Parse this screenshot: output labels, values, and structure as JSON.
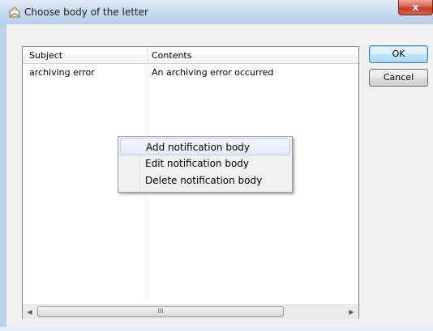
{
  "window": {
    "title": "Choose body of the letter",
    "close_glyph": "x"
  },
  "list": {
    "columns": [
      "Subject",
      "Contents"
    ],
    "rows": [
      {
        "subject": "archiving error",
        "contents": "An archiving error occurred"
      }
    ],
    "scroll": {
      "left_arrow": "◀",
      "right_arrow": "▶",
      "thumb_grip": "III"
    }
  },
  "buttons": {
    "ok": "OK",
    "cancel": "Cancel"
  },
  "context_menu": {
    "items": [
      "Add notification body",
      "Edit notification body",
      "Delete notification body"
    ],
    "highlighted_index": 0
  },
  "icons": [
    "envelope-icon",
    "close-icon",
    "scroll-left-icon",
    "scroll-right-icon"
  ],
  "colors": {
    "title_gradient_top": "#dfeaf6",
    "close_button": "#c33c22",
    "menu_highlight_border": "#aecff7",
    "default_button_border": "#3c7fb1"
  }
}
